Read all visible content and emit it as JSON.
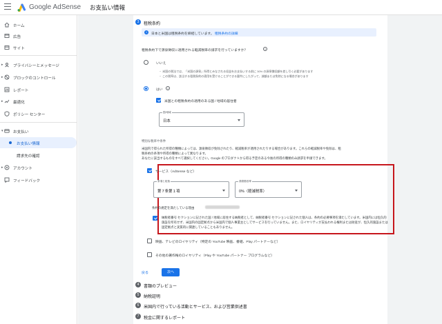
{
  "header": {
    "brand_google": "Google",
    "brand_product": "AdSense",
    "page_title": "お支払い情報"
  },
  "sidebar": {
    "items": [
      {
        "label": "ホーム",
        "icon": "home-icon"
      },
      {
        "label": "広告",
        "icon": "ads-icon"
      },
      {
        "label": "サイト",
        "icon": "sites-icon"
      },
      {
        "label": "プライバシーとメッセージ",
        "icon": "privacy-icon"
      },
      {
        "label": "ブロックのコントロール",
        "icon": "block-icon"
      },
      {
        "label": "レポート",
        "icon": "reports-icon"
      },
      {
        "label": "最適化",
        "icon": "optimize-icon"
      },
      {
        "label": "ポリシー センター",
        "icon": "policy-icon"
      },
      {
        "label": "お支払い",
        "icon": "payments-icon"
      },
      {
        "label": "お支払い情報",
        "icon": "dot"
      },
      {
        "label": "請求先の確認",
        "icon": ""
      },
      {
        "label": "アカウント",
        "icon": "account-icon"
      },
      {
        "label": "フィードバック",
        "icon": "feedback-icon"
      }
    ]
  },
  "form": {
    "step3": {
      "number": "3",
      "title": "租税条約"
    },
    "info": {
      "text": "日本と米国は租税条約を締結しています。",
      "link": "租税条約の詳細"
    },
    "question": "租税条約下で源泉徴収に適用される軽減税率の請求を行っていますか？",
    "option_no": {
      "label": "いいえ",
      "bullet1": "・ 米国の税法では、「米国の源泉」所得とみなされる収益をお支払いする前に 30% の源泉徴収額を差し引く必要があります",
      "bullet2": "・ この税率は、該当する租税条約の適用を受けることができる要件にしたがって、減額または免除になる場合があります"
    },
    "option_yes": {
      "label": "はい"
    },
    "resident_checkbox": "米国との租税条約の適用のある国 / 地域の居住者",
    "country_select": {
      "label": "国/地域",
      "value": "日本"
    },
    "special_rates_title": "特別な税率や条件",
    "special_rates_text1": "米国内で得られた所得の種類によっては、源泉徴収が免除されたり、軽減税率が適用されたりする場合があります。これらの軽減税率や免除は、租",
    "special_rates_text2": "税条約の条項や所得の種類によって異なります。",
    "special_rates_text3": "あなたに該当するものをすべて選択してください。Google のプロダクトから得る予定のある今後の所得の種類のみ請求を申請できます。",
    "services": {
      "label": "サービス（AdSense など）",
      "article_select": {
        "label": "条項と段落",
        "value": "第７条第１項"
      },
      "rate_select": {
        "label": "源泉徴収率",
        "value": "0%（軽減税率）"
      },
      "reason_label": "条約の規定を満たしている理由",
      "attest": "納税者番号 セクションに記された国 / 地域に居住する納税者として、納税者番号 セクションに記された個人は、条約の必要事項を満たしています。米国内には恒久的施設を所有せず、米国内の固定拠点から米国内で個人事業主としてサービスを行っていません。また、ロイヤリティが支払われる権利または財産が、恒久的施設または固定拠点と実質的に関連していることもありません。"
    },
    "film": {
      "label": "映画、テレビのロイヤリティ（特定の YouTube 映画、番組、Play パートナーなど）"
    },
    "other": {
      "label": "その他の著作権のロイヤリティ（Play や YouTube パートナー プログラムなど）"
    },
    "back_label": "戻る",
    "next_label": "次へ",
    "steps": [
      {
        "number": "4",
        "title": "書類のプレビュー"
      },
      {
        "number": "5",
        "title": "納税証明"
      },
      {
        "number": "6",
        "title": "米国内で行っている活動とサービス、および営業供述書"
      },
      {
        "number": "7",
        "title": "税金に関するレポート"
      }
    ]
  },
  "colors": {
    "accent": "#1a73e8",
    "highlight": "#c6151b"
  }
}
